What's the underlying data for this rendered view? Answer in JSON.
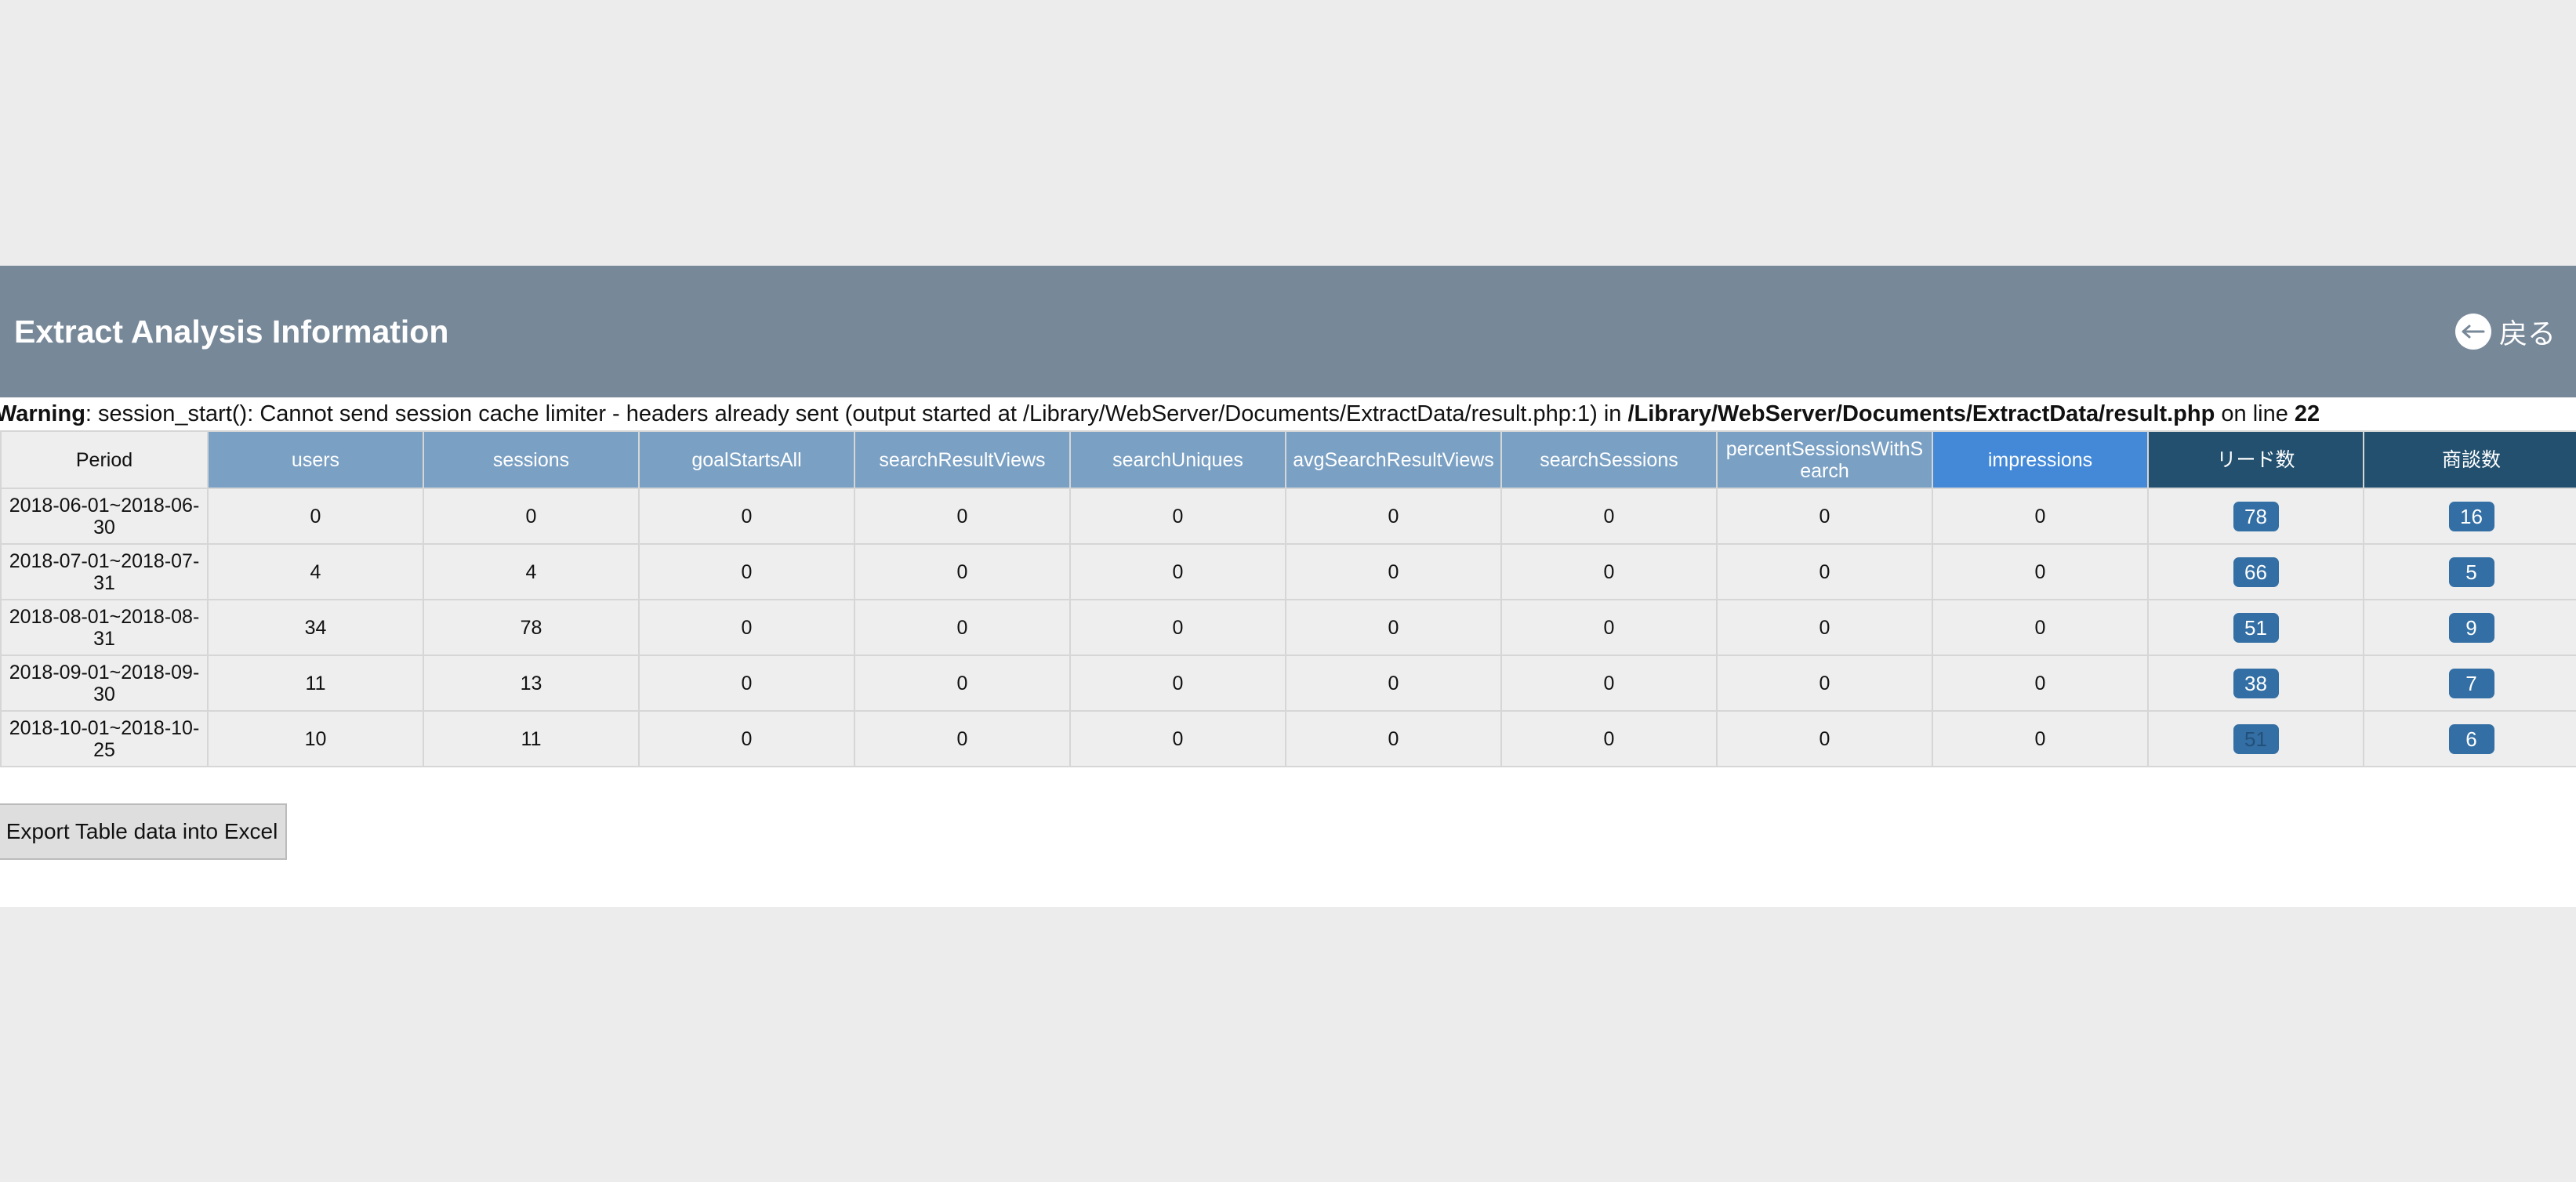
{
  "header": {
    "title": "Extract Analysis Information",
    "back_label": "戻る",
    "back_icon": "arrow-left-circle-icon"
  },
  "warning": {
    "label": "Warning",
    "message": ": session_start(): Cannot send session cache limiter - headers already sent (output started at /Library/WebServer/Documents/ExtractData/result.php:1) in ",
    "path": "/Library/WebServer/Documents/ExtractData/result.php",
    "line_text": " on line ",
    "line_number": "22"
  },
  "table": {
    "columns": [
      "Period",
      "users",
      "sessions",
      "goalStartsAll",
      "searchResultViews",
      "searchUniques",
      "avgSearchResultViews",
      "searchSessions",
      "percentSessionsWithSearch",
      "impressions",
      "リード数",
      "商談数"
    ],
    "rows": [
      [
        "2018-06-01~2018-06-30",
        "0",
        "0",
        "0",
        "0",
        "0",
        "0",
        "0",
        "0",
        "0",
        "78",
        "16"
      ],
      [
        "2018-07-01~2018-07-31",
        "4",
        "4",
        "0",
        "0",
        "0",
        "0",
        "0",
        "0",
        "0",
        "66",
        "5"
      ],
      [
        "2018-08-01~2018-08-31",
        "34",
        "78",
        "0",
        "0",
        "0",
        "0",
        "0",
        "0",
        "0",
        "51",
        "9"
      ],
      [
        "2018-09-01~2018-09-30",
        "11",
        "13",
        "0",
        "0",
        "0",
        "0",
        "0",
        "0",
        "0",
        "38",
        "7"
      ],
      [
        "2018-10-01~2018-10-25",
        "10",
        "11",
        "0",
        "0",
        "0",
        "0",
        "0",
        "0",
        "0",
        "51",
        "6"
      ]
    ]
  },
  "export_button": {
    "label": "Export Table data into Excel"
  },
  "colors": {
    "header_bg": "#778899",
    "column_header": "#7aa0c4",
    "impressions_header": "#4389d8",
    "dark_header": "#23506f",
    "badge": "#336fa4"
  }
}
